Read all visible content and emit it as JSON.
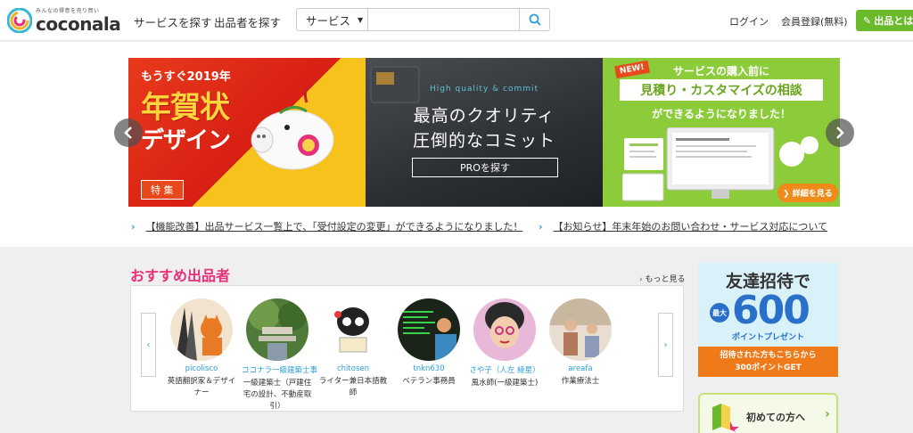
{
  "header": {
    "logo_tagline": "みんなの得意を売り買い",
    "logo_name": "coconala",
    "nav": [
      "サービスを探す",
      "出品者を探す"
    ],
    "search": {
      "category": "サービス",
      "placeholder": ""
    },
    "login": "ログイン",
    "register": "会員登録(無料)",
    "sell_button": "出品とは？"
  },
  "banners": {
    "nenga": {
      "line1": "もうすぐ2019年",
      "line2": "年賀状",
      "line3": "デザイン",
      "badge": "特 集"
    },
    "pro": {
      "sub": "High quality & commit",
      "line1": "最高のクオリティ",
      "line2": "圧倒的なコミット",
      "button": "PROを探す"
    },
    "estimate": {
      "new": "NEW!",
      "line1": "サービスの購入前に",
      "line2": "見積り・カスタマイズの相談",
      "line3": "ができるようになりました！",
      "button": "詳細を見る"
    }
  },
  "news": [
    "【機能改善】出品サービス一覧上で、「受付設定の変更」ができるようになりました！",
    "【お知らせ】年末年始のお問い合わせ・サービス対応について"
  ],
  "recommended": {
    "title": "おすすめ出品者",
    "more": "もっと見る",
    "sellers": [
      {
        "name": "picolisco",
        "desc": "英語翻訳家＆デザイナー"
      },
      {
        "name": "ココナラ一級建築士事",
        "desc": "一級建築士（戸建住宅の設計、不動産取引）"
      },
      {
        "name": "chitosen",
        "desc": "ライター兼日本語教師"
      },
      {
        "name": "tnkn630",
        "desc": "ベテラン事務員"
      },
      {
        "name": "さや子（人左 綾星）",
        "desc": "風水師(一級建築士)"
      },
      {
        "name": "areafa",
        "desc": "作業療法士"
      }
    ]
  },
  "promo": {
    "title": "友達招待で",
    "max": "最大",
    "amount": "600",
    "point_label": "ポイントプレゼント",
    "bar_line1": "招待された方もこちらから",
    "bar_line2": "300ポイントGET"
  },
  "first_time": "初めての方へ",
  "colors": {
    "accent_green": "#6aba2c",
    "link_blue": "#2a9fd6",
    "pink": "#e8307a",
    "orange": "#ee7a1a"
  }
}
